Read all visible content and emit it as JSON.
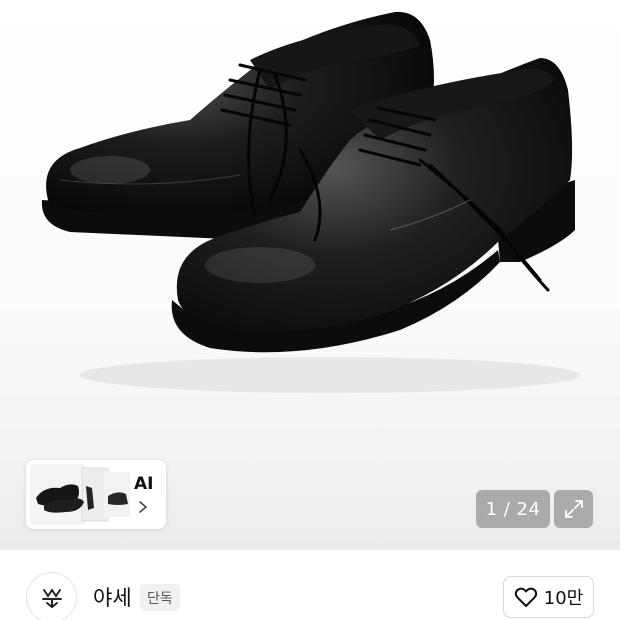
{
  "gallery": {
    "ai_label": "AI",
    "page_counter": "1 / 24",
    "expand_icon": "expand-arrows-icon"
  },
  "brand": {
    "name": "야세",
    "badge": "단독",
    "logo_icon": "brand-logo-icon"
  },
  "like": {
    "icon": "heart-outline-icon",
    "count": "10만"
  }
}
